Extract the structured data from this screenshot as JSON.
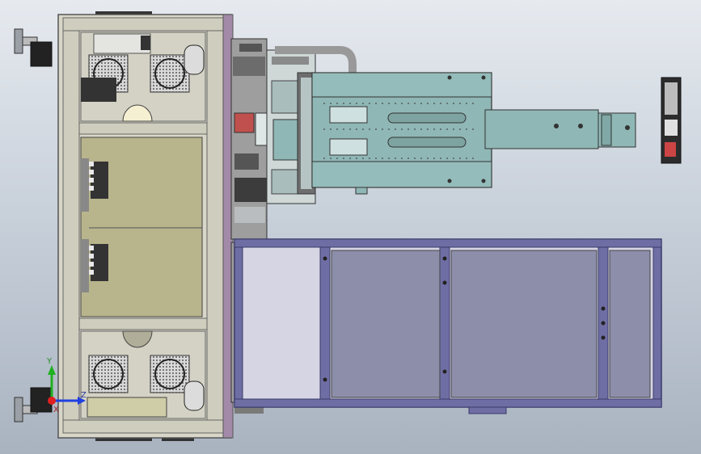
{
  "window": {
    "title": ""
  },
  "viewport": {
    "background_top": "#e6eaef",
    "background_bottom": "#a9b3c0",
    "model": {
      "frame_color": "#d8d6c8",
      "frame_edge": "#555555",
      "tray_color": "#8fb7b5",
      "conveyor_color": "#6f6ea4",
      "conveyor_edge": "#3a3a6a",
      "panel_color": "#b8b48c",
      "accent_pink": "#b07aa0",
      "accent_red": "#c0504d"
    }
  },
  "triad": {
    "x_label": "X",
    "y_label": "Y",
    "z_label": "Z",
    "x_color": "#e02020",
    "y_color": "#20b020",
    "z_color": "#2040e0"
  }
}
